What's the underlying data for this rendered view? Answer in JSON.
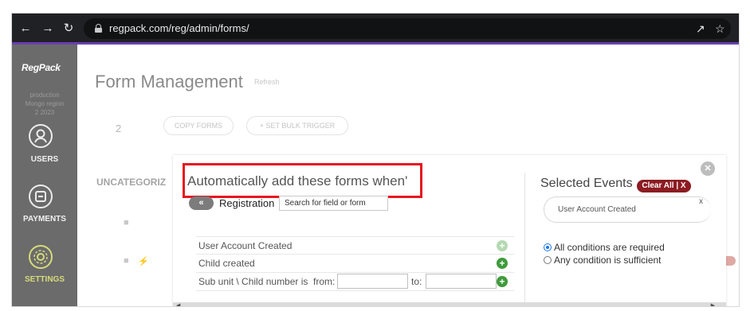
{
  "browser": {
    "url": "regpack.com/reg/admin/forms/",
    "icons": [
      "back-arrow-icon",
      "forward-arrow-icon",
      "reload-icon",
      "lock-icon",
      "share-icon",
      "star-icon"
    ]
  },
  "sidebar": {
    "logo": "RegPack",
    "env_line1": "production",
    "env_line2": "Mongo region",
    "env_line3": "2 2023",
    "items": [
      {
        "label": "USERS",
        "icon": "user-icon"
      },
      {
        "label": "PAYMENTS",
        "icon": "payments-icon"
      },
      {
        "label": "SETTINGS",
        "icon": "settings-icon"
      }
    ]
  },
  "page": {
    "title": "Form Management",
    "refresh": "Refresh",
    "count": "2",
    "copy_forms": "COPY FORMS",
    "bulk_trigger": "+ SET BULK TRIGGER",
    "uncategorized": "UNCATEGORIZ"
  },
  "modal": {
    "title": "Automatically add these forms when'",
    "back_glyph": "«",
    "registration_label": "Registration",
    "search_placeholder": "Search for field or form",
    "events": [
      {
        "label": "User Account Created"
      },
      {
        "label": "Child created"
      }
    ],
    "range_event": {
      "label": "Sub unit \\ Child number is",
      "from_label": "from:",
      "to_label": "to:",
      "from_value": "",
      "to_value": ""
    },
    "selected": {
      "title": "Selected Events",
      "clear_all": "Clear All | X",
      "chip_label": "User Account Created",
      "chip_close": "x"
    },
    "conditions": [
      {
        "label": "All conditions are required",
        "checked": true
      },
      {
        "label": "Any condition is sufficient",
        "checked": false
      }
    ],
    "colors": {
      "highlight": "#e8131f",
      "clear_all_bg": "#8c1b22",
      "add_green": "#3e9b3b",
      "browser_accent": "#6a3fb0"
    }
  }
}
